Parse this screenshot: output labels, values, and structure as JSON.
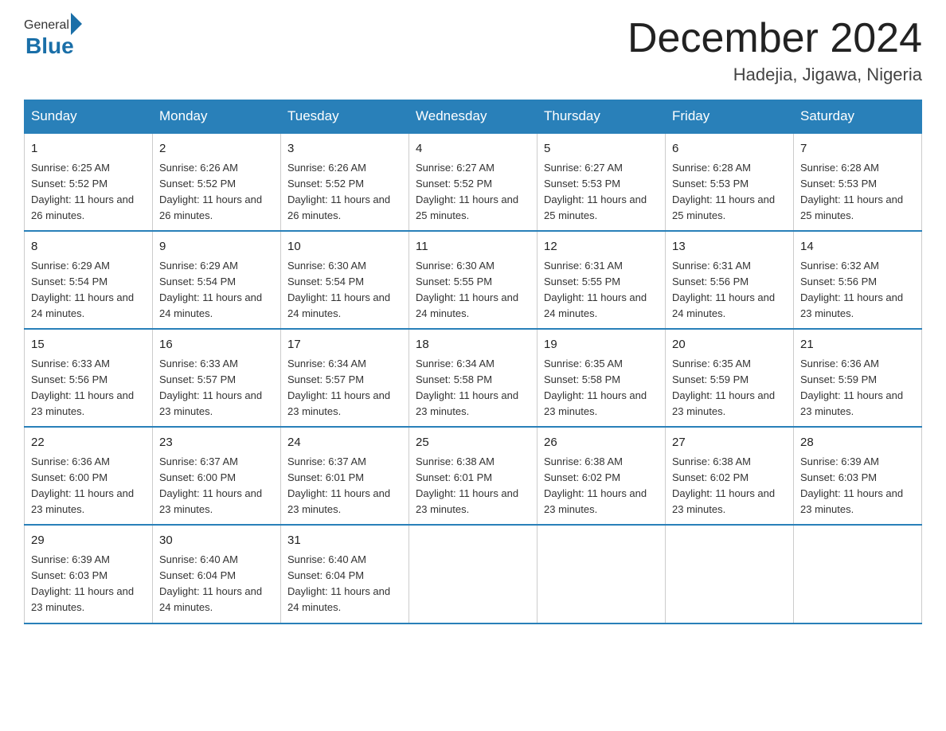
{
  "header": {
    "title": "December 2024",
    "location": "Hadejia, Jigawa, Nigeria",
    "logo_general": "General",
    "logo_blue": "Blue"
  },
  "columns": [
    "Sunday",
    "Monday",
    "Tuesday",
    "Wednesday",
    "Thursday",
    "Friday",
    "Saturday"
  ],
  "weeks": [
    [
      {
        "day": "1",
        "sunrise": "Sunrise: 6:25 AM",
        "sunset": "Sunset: 5:52 PM",
        "daylight": "Daylight: 11 hours and 26 minutes."
      },
      {
        "day": "2",
        "sunrise": "Sunrise: 6:26 AM",
        "sunset": "Sunset: 5:52 PM",
        "daylight": "Daylight: 11 hours and 26 minutes."
      },
      {
        "day": "3",
        "sunrise": "Sunrise: 6:26 AM",
        "sunset": "Sunset: 5:52 PM",
        "daylight": "Daylight: 11 hours and 26 minutes."
      },
      {
        "day": "4",
        "sunrise": "Sunrise: 6:27 AM",
        "sunset": "Sunset: 5:52 PM",
        "daylight": "Daylight: 11 hours and 25 minutes."
      },
      {
        "day": "5",
        "sunrise": "Sunrise: 6:27 AM",
        "sunset": "Sunset: 5:53 PM",
        "daylight": "Daylight: 11 hours and 25 minutes."
      },
      {
        "day": "6",
        "sunrise": "Sunrise: 6:28 AM",
        "sunset": "Sunset: 5:53 PM",
        "daylight": "Daylight: 11 hours and 25 minutes."
      },
      {
        "day": "7",
        "sunrise": "Sunrise: 6:28 AM",
        "sunset": "Sunset: 5:53 PM",
        "daylight": "Daylight: 11 hours and 25 minutes."
      }
    ],
    [
      {
        "day": "8",
        "sunrise": "Sunrise: 6:29 AM",
        "sunset": "Sunset: 5:54 PM",
        "daylight": "Daylight: 11 hours and 24 minutes."
      },
      {
        "day": "9",
        "sunrise": "Sunrise: 6:29 AM",
        "sunset": "Sunset: 5:54 PM",
        "daylight": "Daylight: 11 hours and 24 minutes."
      },
      {
        "day": "10",
        "sunrise": "Sunrise: 6:30 AM",
        "sunset": "Sunset: 5:54 PM",
        "daylight": "Daylight: 11 hours and 24 minutes."
      },
      {
        "day": "11",
        "sunrise": "Sunrise: 6:30 AM",
        "sunset": "Sunset: 5:55 PM",
        "daylight": "Daylight: 11 hours and 24 minutes."
      },
      {
        "day": "12",
        "sunrise": "Sunrise: 6:31 AM",
        "sunset": "Sunset: 5:55 PM",
        "daylight": "Daylight: 11 hours and 24 minutes."
      },
      {
        "day": "13",
        "sunrise": "Sunrise: 6:31 AM",
        "sunset": "Sunset: 5:56 PM",
        "daylight": "Daylight: 11 hours and 24 minutes."
      },
      {
        "day": "14",
        "sunrise": "Sunrise: 6:32 AM",
        "sunset": "Sunset: 5:56 PM",
        "daylight": "Daylight: 11 hours and 23 minutes."
      }
    ],
    [
      {
        "day": "15",
        "sunrise": "Sunrise: 6:33 AM",
        "sunset": "Sunset: 5:56 PM",
        "daylight": "Daylight: 11 hours and 23 minutes."
      },
      {
        "day": "16",
        "sunrise": "Sunrise: 6:33 AM",
        "sunset": "Sunset: 5:57 PM",
        "daylight": "Daylight: 11 hours and 23 minutes."
      },
      {
        "day": "17",
        "sunrise": "Sunrise: 6:34 AM",
        "sunset": "Sunset: 5:57 PM",
        "daylight": "Daylight: 11 hours and 23 minutes."
      },
      {
        "day": "18",
        "sunrise": "Sunrise: 6:34 AM",
        "sunset": "Sunset: 5:58 PM",
        "daylight": "Daylight: 11 hours and 23 minutes."
      },
      {
        "day": "19",
        "sunrise": "Sunrise: 6:35 AM",
        "sunset": "Sunset: 5:58 PM",
        "daylight": "Daylight: 11 hours and 23 minutes."
      },
      {
        "day": "20",
        "sunrise": "Sunrise: 6:35 AM",
        "sunset": "Sunset: 5:59 PM",
        "daylight": "Daylight: 11 hours and 23 minutes."
      },
      {
        "day": "21",
        "sunrise": "Sunrise: 6:36 AM",
        "sunset": "Sunset: 5:59 PM",
        "daylight": "Daylight: 11 hours and 23 minutes."
      }
    ],
    [
      {
        "day": "22",
        "sunrise": "Sunrise: 6:36 AM",
        "sunset": "Sunset: 6:00 PM",
        "daylight": "Daylight: 11 hours and 23 minutes."
      },
      {
        "day": "23",
        "sunrise": "Sunrise: 6:37 AM",
        "sunset": "Sunset: 6:00 PM",
        "daylight": "Daylight: 11 hours and 23 minutes."
      },
      {
        "day": "24",
        "sunrise": "Sunrise: 6:37 AM",
        "sunset": "Sunset: 6:01 PM",
        "daylight": "Daylight: 11 hours and 23 minutes."
      },
      {
        "day": "25",
        "sunrise": "Sunrise: 6:38 AM",
        "sunset": "Sunset: 6:01 PM",
        "daylight": "Daylight: 11 hours and 23 minutes."
      },
      {
        "day": "26",
        "sunrise": "Sunrise: 6:38 AM",
        "sunset": "Sunset: 6:02 PM",
        "daylight": "Daylight: 11 hours and 23 minutes."
      },
      {
        "day": "27",
        "sunrise": "Sunrise: 6:38 AM",
        "sunset": "Sunset: 6:02 PM",
        "daylight": "Daylight: 11 hours and 23 minutes."
      },
      {
        "day": "28",
        "sunrise": "Sunrise: 6:39 AM",
        "sunset": "Sunset: 6:03 PM",
        "daylight": "Daylight: 11 hours and 23 minutes."
      }
    ],
    [
      {
        "day": "29",
        "sunrise": "Sunrise: 6:39 AM",
        "sunset": "Sunset: 6:03 PM",
        "daylight": "Daylight: 11 hours and 23 minutes."
      },
      {
        "day": "30",
        "sunrise": "Sunrise: 6:40 AM",
        "sunset": "Sunset: 6:04 PM",
        "daylight": "Daylight: 11 hours and 24 minutes."
      },
      {
        "day": "31",
        "sunrise": "Sunrise: 6:40 AM",
        "sunset": "Sunset: 6:04 PM",
        "daylight": "Daylight: 11 hours and 24 minutes."
      },
      {
        "day": "",
        "sunrise": "",
        "sunset": "",
        "daylight": ""
      },
      {
        "day": "",
        "sunrise": "",
        "sunset": "",
        "daylight": ""
      },
      {
        "day": "",
        "sunrise": "",
        "sunset": "",
        "daylight": ""
      },
      {
        "day": "",
        "sunrise": "",
        "sunset": "",
        "daylight": ""
      }
    ]
  ]
}
